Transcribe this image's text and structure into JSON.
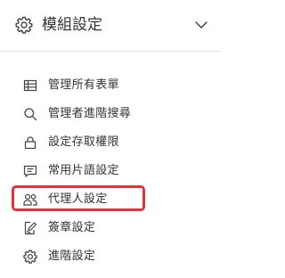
{
  "header": {
    "title": "模組設定",
    "icon": "gear-icon",
    "toggle_icon": "chevron-down-icon"
  },
  "menu": {
    "items": [
      {
        "label": "管理所有表單",
        "icon": "table-icon"
      },
      {
        "label": "管理者進階搜尋",
        "icon": "search-icon"
      },
      {
        "label": "設定存取權限",
        "icon": "lock-icon"
      },
      {
        "label": "常用片語設定",
        "icon": "message-icon"
      },
      {
        "label": "代理人設定",
        "icon": "users-icon",
        "highlighted": true
      },
      {
        "label": "簽章設定",
        "icon": "signature-icon"
      },
      {
        "label": "進階設定",
        "icon": "gear-icon"
      }
    ]
  },
  "colors": {
    "text": "#333333",
    "icon": "#444444",
    "divider": "#dedede",
    "highlight_border": "#e8303a"
  }
}
